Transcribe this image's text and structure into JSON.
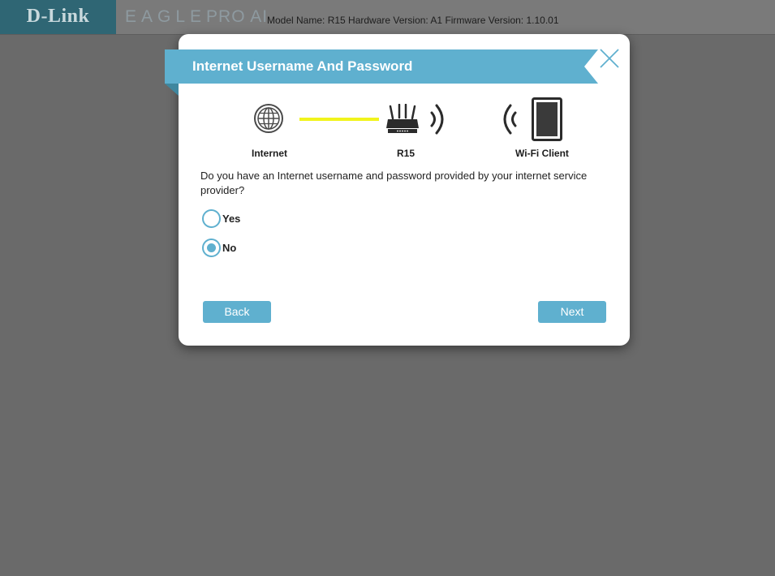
{
  "header": {
    "brand": "D-Link",
    "product_strong": "EAGLE",
    "product_light": "PRO AI",
    "model_info": "Model Name: R15 Hardware Version: A1 Firmware Version: 1.10.01"
  },
  "dialog": {
    "title": "Internet Username And Password",
    "diagram": {
      "internet_label": "Internet",
      "router_label": "R15",
      "client_label": "Wi-Fi Client"
    },
    "question": "Do you have an Internet username and password provided by your internet service provider?",
    "options": [
      {
        "label": "Yes",
        "selected": false
      },
      {
        "label": "No",
        "selected": true
      }
    ],
    "back_label": "Back",
    "next_label": "Next"
  },
  "colors": {
    "accent": "#5fb0cf",
    "link_line": "#f1f41c",
    "brand_bg": "#2f6674",
    "overlay_bg": "#6a6a6a"
  }
}
